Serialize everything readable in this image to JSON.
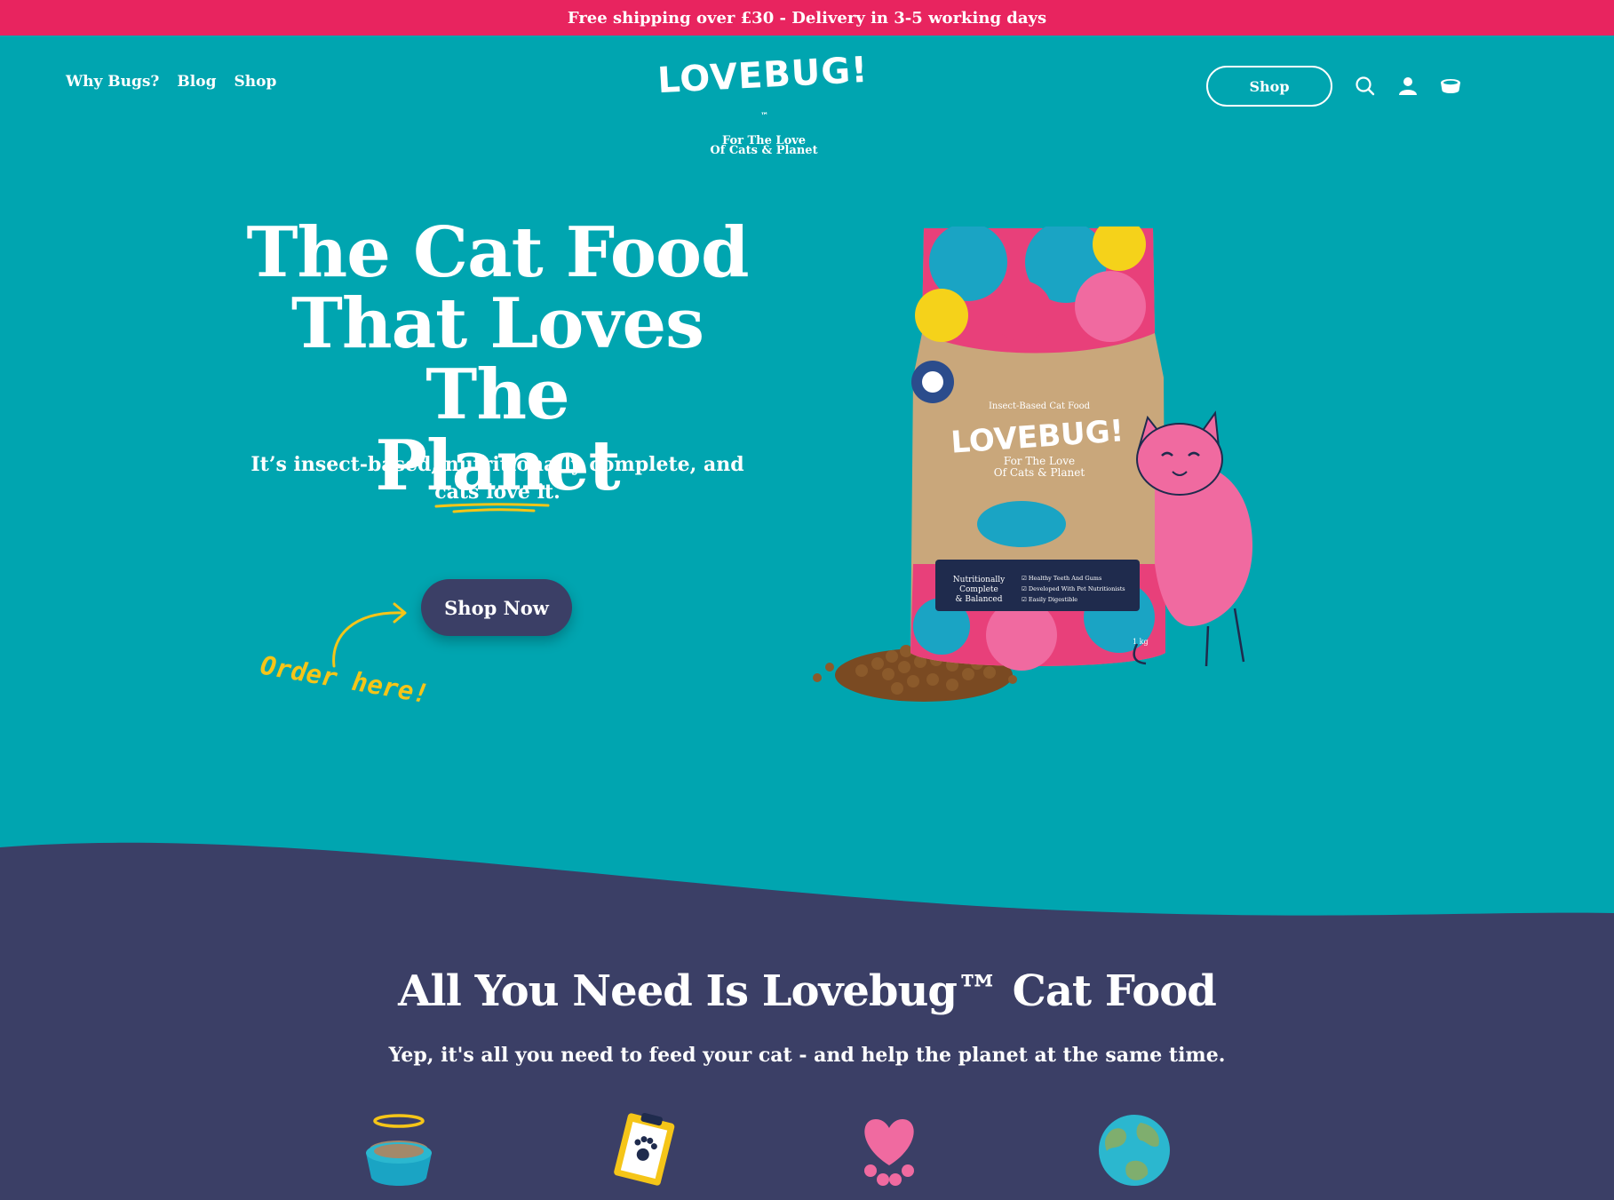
{
  "announcement": {
    "text": "Free shipping over £30 - Delivery in 3-5 working days"
  },
  "nav": {
    "items": [
      "Why Bugs?",
      "Blog",
      "Shop"
    ]
  },
  "logo": {
    "word": "LOVEBUG!",
    "tm": "™",
    "tagline1": "For The Love",
    "tagline2": "Of Cats & Planet"
  },
  "header": {
    "shop_label": "Shop",
    "icons": [
      "search-icon",
      "account-icon",
      "cart-bowl-icon"
    ]
  },
  "hero": {
    "title_line1": "The Cat Food",
    "title_line2": "That Loves The",
    "title_line3": "Planet",
    "subtitle_part1": "It’s insect-based, nutritionally complete, and",
    "subtitle_part2": "cats love it.",
    "cta_label": "Shop Now",
    "order_note": "Order here!"
  },
  "product": {
    "bag_label_top": "Insect-Based Cat Food",
    "bag_brand": "LOVEBUG!",
    "bag_tagline1": "For The Love",
    "bag_tagline2": "Of Cats & Planet",
    "panel_title1": "Nutritionally",
    "panel_title2": "Complete",
    "panel_title3": "& Balanced",
    "panel_points": [
      "Healthy Teeth And Gums",
      "Developed With Pet Nutritionists",
      "Easily Digestible"
    ],
    "weight": "1 kg"
  },
  "section": {
    "title": "All You Need Is Lovebug™ Cat Food",
    "subtitle": "Yep, it's all you need to feed your cat - and help the planet at the same time.",
    "features": [
      "food-bowl-halo-icon",
      "clipboard-paw-icon",
      "heart-paw-icon",
      "earth-icon"
    ]
  },
  "colors": {
    "teal": "#00a5b0",
    "pink": "#e8245f",
    "navy": "#3b3f66",
    "yellow": "#f5c518"
  }
}
